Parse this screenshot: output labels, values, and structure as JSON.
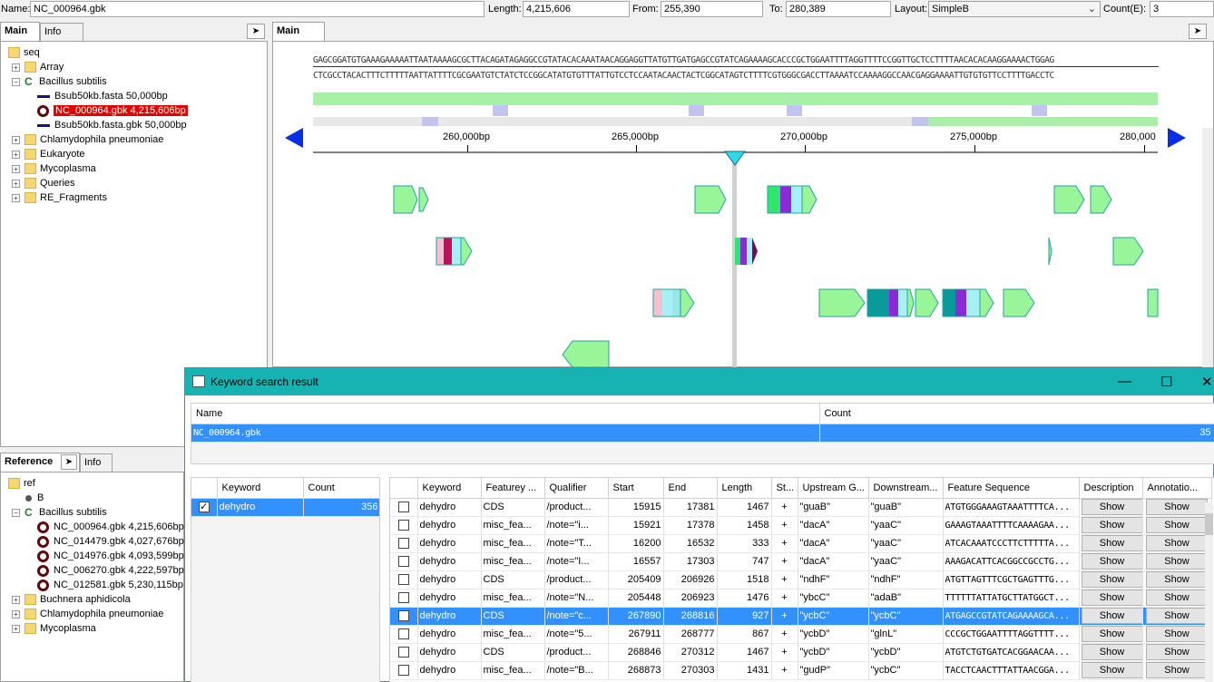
{
  "toolbar": {
    "name_label": "Name:",
    "name_value": "NC_000964.gbk",
    "length_label": "Length:",
    "length_value": "4,215,606",
    "from_label": "From:",
    "from_value": "255,390",
    "to_label": "To:",
    "to_value": "280,389",
    "layout_label": "Layout:",
    "layout_value": "SimpleB",
    "count_label": "Count(E):",
    "count_value": "3"
  },
  "left_top": {
    "tabs": [
      "Main",
      "Info"
    ],
    "tree": [
      {
        "label": "seq",
        "type": "folder",
        "level": 0
      },
      {
        "label": "Array",
        "type": "folder",
        "level": 1
      },
      {
        "label": "Bacillus subtilis",
        "type": "genome",
        "level": 1
      },
      {
        "label": "Bsub50kb.fasta 50,000bp",
        "type": "bar",
        "level": 2
      },
      {
        "label": "NC_000964.gbk 4,215,606bp",
        "type": "ring",
        "level": 2,
        "selected": true
      },
      {
        "label": "Bsub50kb.fasta.gbk 50,000bp",
        "type": "bar",
        "level": 2
      },
      {
        "label": "Chlamydophila pneumoniae",
        "type": "folder",
        "level": 1
      },
      {
        "label": "Eukaryote",
        "type": "folder",
        "level": 1
      },
      {
        "label": "Mycoplasma",
        "type": "folder",
        "level": 1
      },
      {
        "label": "Queries",
        "type": "folder",
        "level": 1
      },
      {
        "label": "RE_Fragments",
        "type": "folder",
        "level": 1
      }
    ]
  },
  "left_bottom": {
    "tabs": [
      "Reference",
      "Info"
    ],
    "tree": [
      {
        "label": "ref",
        "type": "folder",
        "level": 0
      },
      {
        "label": "B",
        "type": "dot",
        "level": 1
      },
      {
        "label": "Bacillus subtilis",
        "type": "genome",
        "level": 1
      },
      {
        "label": "NC_000964.gbk 4,215,606bp",
        "type": "ring",
        "level": 2
      },
      {
        "label": "NC_014479.gbk 4,027,676bp",
        "type": "ring",
        "level": 2
      },
      {
        "label": "NC_014976.gbk 4,093,599bp",
        "type": "ring",
        "level": 2
      },
      {
        "label": "NC_006270.gbk 4,222,597bp",
        "type": "ring",
        "level": 2
      },
      {
        "label": "NC_012581.gbk 5,230,115bp",
        "type": "ring",
        "level": 2
      },
      {
        "label": "Buchnera aphidicola",
        "type": "folder",
        "level": 1
      },
      {
        "label": "Chlamydophila pneumoniae",
        "type": "folder",
        "level": 1
      },
      {
        "label": "Mycoplasma",
        "type": "folder",
        "level": 1
      }
    ]
  },
  "main": {
    "tab": "Main",
    "seq_forward": "GAGCGGATGTGAAAGAAAAATTAATAAAAGCGCTTACAGATAGAGGCCGTATACACAAATAACAGGAGGTTATGTTGATGAGCCGTATCAGAAAAGCACCCGCTGGAATTTTAGGTTTTCCGGTTGCTCCTTTTAACACACAAGGAAAACTGGAG",
    "seq_reverse": "CTCGCCTACACTTTCTTTTTAATTATTTTCGCGAATGTCTATCTCCGGCATATGTGTTTATTGTCCTCCAATACAACTACTCGGCATAGTCTTTTCGTGGGCGACCTTAAAATCCAAAAGGCCAACGAGGAAAATTGTGTGTTCCTTTTGACCTC",
    "ticks": [
      "260,000bp",
      "265,000bp",
      "270,000bp",
      "275,000bp",
      "280,000"
    ]
  },
  "dialog": {
    "title": "Keyword search result",
    "file_headers": [
      "Name",
      "Count"
    ],
    "file_row": {
      "name": "NC_000964.gbk",
      "count": "35"
    },
    "kw_headers": [
      "Keyword",
      "Count"
    ],
    "kw_row": {
      "keyword": "dehydro",
      "count": "356",
      "checked": true
    },
    "result_headers": [
      "Keyword",
      "Featurey ...",
      "Qualifier",
      "Start",
      "End",
      "Length",
      "St...",
      "Upstream G...",
      "Downstream...",
      "Feature Sequence",
      "Description",
      "Annotatio..."
    ],
    "button_label": "Show",
    "rows": [
      {
        "keyword": "dehydro",
        "feature": "CDS",
        "qualifier": "/product...",
        "start": "15915",
        "end": "17381",
        "length": "1467",
        "strand": "+",
        "up": "\"guaB\"",
        "down": "\"guaB\"",
        "seq": "ATGTGGGAAAGTAAATTTTCA..."
      },
      {
        "keyword": "dehydro",
        "feature": "misc_fea...",
        "qualifier": "/note=\"i...",
        "start": "15921",
        "end": "17378",
        "length": "1458",
        "strand": "+",
        "up": "\"dacA\"",
        "down": "\"yaaC\"",
        "seq": "GAAAGTAAATTTTCAAAAGAA..."
      },
      {
        "keyword": "dehydro",
        "feature": "misc_fea...",
        "qualifier": "/note=\"T...",
        "start": "16200",
        "end": "16532",
        "length": "333",
        "strand": "+",
        "up": "\"dacA\"",
        "down": "\"yaaC\"",
        "seq": "ATCACAAATCCCTTCTTTTTA..."
      },
      {
        "keyword": "dehydro",
        "feature": "misc_fea...",
        "qualifier": "/note=\"I...",
        "start": "16557",
        "end": "17303",
        "length": "747",
        "strand": "+",
        "up": "\"dacA\"",
        "down": "\"yaaC\"",
        "seq": "AAAGACATTCACGGCCGCCTG..."
      },
      {
        "keyword": "dehydro",
        "feature": "CDS",
        "qualifier": "/product...",
        "start": "205409",
        "end": "206926",
        "length": "1518",
        "strand": "+",
        "up": "\"ndhF\"",
        "down": "\"ndhF\"",
        "seq": "ATGTTAGTTTCGCTGAGTTTG..."
      },
      {
        "keyword": "dehydro",
        "feature": "misc_fea...",
        "qualifier": "/note=\"N...",
        "start": "205448",
        "end": "206923",
        "length": "1476",
        "strand": "+",
        "up": "\"ybcC\"",
        "down": "\"adaB\"",
        "seq": "TTTTTTATTATGCTTATGGCT..."
      },
      {
        "keyword": "dehydro",
        "feature": "CDS",
        "qualifier": "/note=\"c...",
        "start": "267890",
        "end": "268816",
        "length": "927",
        "strand": "+",
        "up": "\"ycbC\"",
        "down": "\"ycbC\"",
        "seq": "ATGAGCCGTATCAGAAAAGCA...",
        "selected": true
      },
      {
        "keyword": "dehydro",
        "feature": "misc_fea...",
        "qualifier": "/note=\"5...",
        "start": "267911",
        "end": "268777",
        "length": "867",
        "strand": "+",
        "up": "\"ycbD\"",
        "down": "\"glnL\"",
        "seq": "CCCGCTGGAATTTTAGGTTTT..."
      },
      {
        "keyword": "dehydro",
        "feature": "CDS",
        "qualifier": "/product...",
        "start": "268846",
        "end": "270312",
        "length": "1467",
        "strand": "+",
        "up": "\"ycbD\"",
        "down": "\"ycbD\"",
        "seq": "ATGTCTGTGATCACGGAACAA..."
      },
      {
        "keyword": "dehydro",
        "feature": "misc_fea...",
        "qualifier": "/note=\"B...",
        "start": "268873",
        "end": "270303",
        "length": "1431",
        "strand": "+",
        "up": "\"gudP\"",
        "down": "\"ycbC\"",
        "seq": "TACCTCAACTTTATTAACGGA..."
      }
    ]
  },
  "colors": {
    "teal_titlebar": "#17b3b3",
    "selection_blue": "#3391ff",
    "gene_green": "#98f598",
    "tree_highlight": "#e00000",
    "nav_arrow": "#0a2ee6"
  }
}
